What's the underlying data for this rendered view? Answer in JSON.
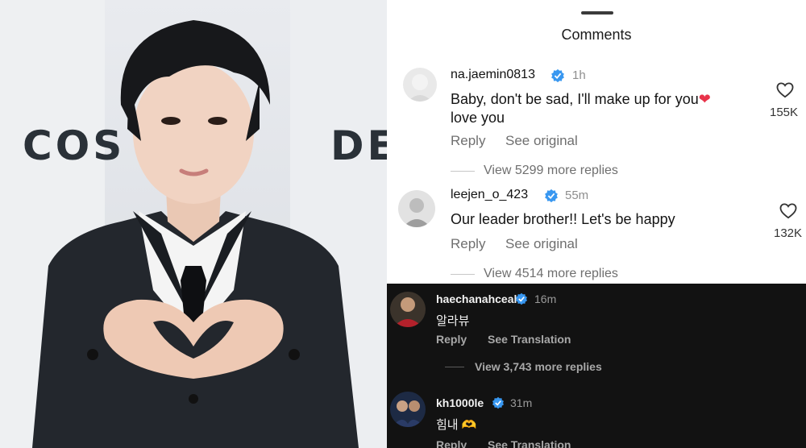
{
  "photo": {
    "backdrop_left_text": "COS",
    "backdrop_right_text": "DE"
  },
  "sheet": {
    "title": "Comments"
  },
  "comments": [
    {
      "username": "na.jaemin0813",
      "time": "1h",
      "text_line1": "Baby, don't be sad, I'll make up for you",
      "emoji": "❤",
      "text_line2": "love you",
      "reply": "Reply",
      "see_original": "See original",
      "likes": "155K",
      "view_replies": "View 5299 more replies"
    },
    {
      "username": "leejen_o_423",
      "time": "55m",
      "text_line1": "Our leader brother!! Let's be happy",
      "reply": "Reply",
      "see_original": "See original",
      "likes": "132K",
      "view_replies": "View 4514 more replies"
    }
  ],
  "dark_comments": [
    {
      "username": "haechanahceah",
      "time": "16m",
      "text": "알라뷰",
      "reply": "Reply",
      "see_translation": "See Translation",
      "view_replies": "View 3,743 more replies"
    },
    {
      "username": "kh1000le",
      "time": "31m",
      "text": "힘내",
      "emoji": "🫶",
      "reply": "Reply",
      "see_translation": "See Translation"
    }
  ],
  "colors": {
    "verified_blue": "#3897f0",
    "heart_red": "#e8334a",
    "dark_bg": "#121212"
  },
  "icons": [
    "verified-badge-icon",
    "heart-outline-icon"
  ]
}
